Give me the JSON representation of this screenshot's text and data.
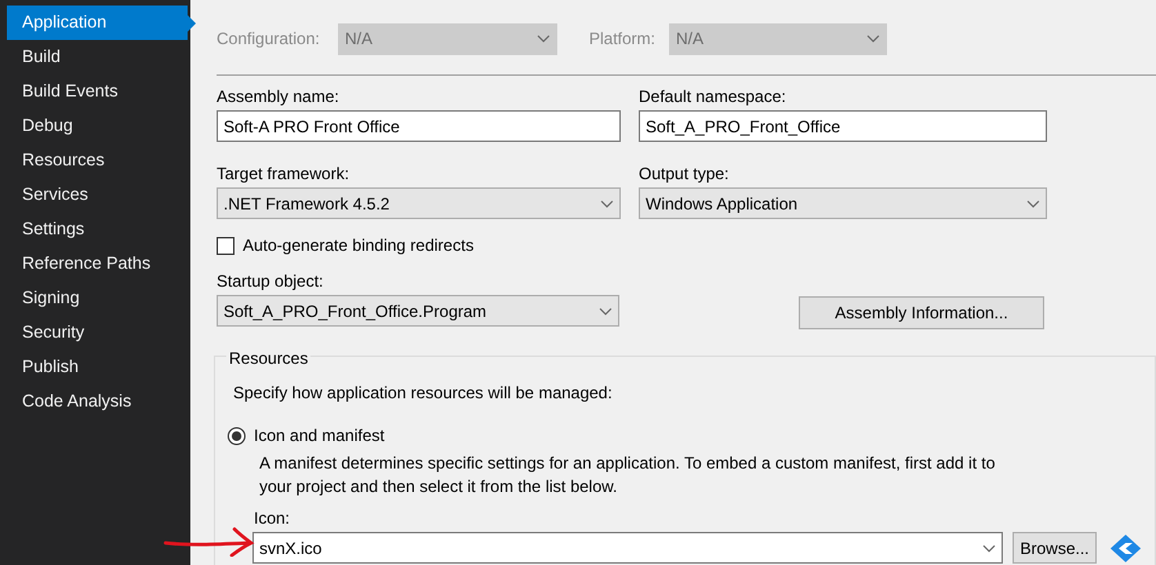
{
  "sidebar": {
    "items": [
      {
        "label": "Application",
        "selected": true
      },
      {
        "label": "Build",
        "selected": false
      },
      {
        "label": "Build Events",
        "selected": false
      },
      {
        "label": "Debug",
        "selected": false
      },
      {
        "label": "Resources",
        "selected": false
      },
      {
        "label": "Services",
        "selected": false
      },
      {
        "label": "Settings",
        "selected": false
      },
      {
        "label": "Reference Paths",
        "selected": false
      },
      {
        "label": "Signing",
        "selected": false
      },
      {
        "label": "Security",
        "selected": false
      },
      {
        "label": "Publish",
        "selected": false
      },
      {
        "label": "Code Analysis",
        "selected": false
      }
    ]
  },
  "configuration": {
    "label": "Configuration:",
    "value": "N/A",
    "disabled": true
  },
  "platform": {
    "label": "Platform:",
    "value": "N/A",
    "disabled": true
  },
  "assembly_name": {
    "label": "Assembly name:",
    "value": "Soft-A PRO Front Office"
  },
  "default_namespace": {
    "label": "Default namespace:",
    "value": "Soft_A_PRO_Front_Office"
  },
  "target_framework": {
    "label": "Target framework:",
    "value": ".NET Framework 4.5.2"
  },
  "output_type": {
    "label": "Output type:",
    "value": "Windows Application"
  },
  "auto_generate": {
    "label": "Auto-generate binding redirects",
    "checked": false
  },
  "startup_object": {
    "label": "Startup object:",
    "value": "Soft_A_PRO_Front_Office.Program"
  },
  "assembly_info_button": "Assembly Information...",
  "resources": {
    "title": "Resources",
    "hint": "Specify how application resources will be managed:",
    "option": {
      "label": "Icon and manifest",
      "selected": true
    },
    "description": "A manifest determines specific settings for an application. To embed a custom manifest, first add it to your project and then select it from the list below.",
    "icon_label": "Icon:",
    "icon_value": "svnX.ico",
    "browse_button": "Browse..."
  }
}
